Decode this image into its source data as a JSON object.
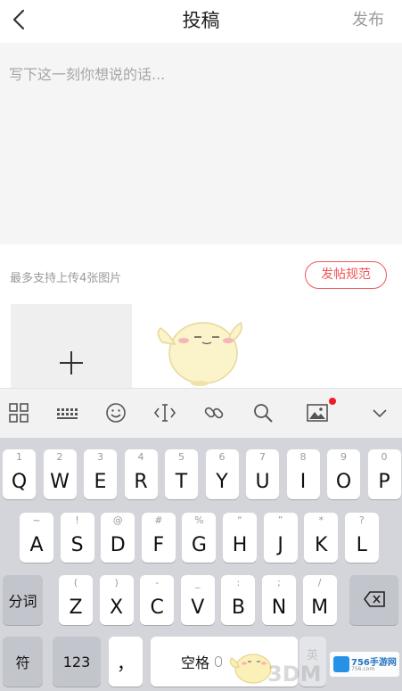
{
  "header": {
    "title": "投稿",
    "publish_label": "发布"
  },
  "editor": {
    "placeholder": "写下这一刻你想说的话..."
  },
  "upload": {
    "hint": "最多支持上传4张图片",
    "rules_label": "发帖规范"
  },
  "toolbar": {
    "icons": [
      "grid-icon",
      "keyboard-icon",
      "emoji-icon",
      "cursor-icon",
      "link-icon",
      "search-icon",
      "image-icon",
      "collapse-icon"
    ],
    "badge_color": "#ee1c24"
  },
  "keyboard": {
    "row1": [
      {
        "sub": "1",
        "main": "Q"
      },
      {
        "sub": "2",
        "main": "W"
      },
      {
        "sub": "3",
        "main": "E"
      },
      {
        "sub": "4",
        "main": "R"
      },
      {
        "sub": "5",
        "main": "T"
      },
      {
        "sub": "6",
        "main": "Y"
      },
      {
        "sub": "7",
        "main": "U"
      },
      {
        "sub": "8",
        "main": "I"
      },
      {
        "sub": "9",
        "main": "O"
      },
      {
        "sub": "0",
        "main": "P"
      }
    ],
    "row2": [
      {
        "sub": "~",
        "main": "A"
      },
      {
        "sub": "!",
        "main": "S"
      },
      {
        "sub": "@",
        "main": "D"
      },
      {
        "sub": "#",
        "main": "F"
      },
      {
        "sub": "%",
        "main": "G"
      },
      {
        "sub": "“",
        "main": "H"
      },
      {
        "sub": "”",
        "main": "J"
      },
      {
        "sub": "*",
        "main": "K"
      },
      {
        "sub": "?",
        "main": "L"
      }
    ],
    "row3": [
      {
        "sub": "(",
        "main": "Z"
      },
      {
        "sub": ")",
        "main": "X"
      },
      {
        "sub": "-",
        "main": "C"
      },
      {
        "sub": "_",
        "main": "V"
      },
      {
        "sub": ":",
        "main": "B"
      },
      {
        "sub": ";",
        "main": "N"
      },
      {
        "sub": "/",
        "main": "M"
      }
    ],
    "segment_label": "分词",
    "symbol_label": "符",
    "number_label": "123",
    "comma_label": "，",
    "space_label": "空格",
    "lang_label": "英"
  },
  "watermark": {
    "brand": "756手游网",
    "ghost": "3DM",
    "url": "756.com"
  },
  "colors": {
    "accent": "#f0565a",
    "header_bg": "#ffffff",
    "keyboard_bg": "#d3d5da"
  }
}
